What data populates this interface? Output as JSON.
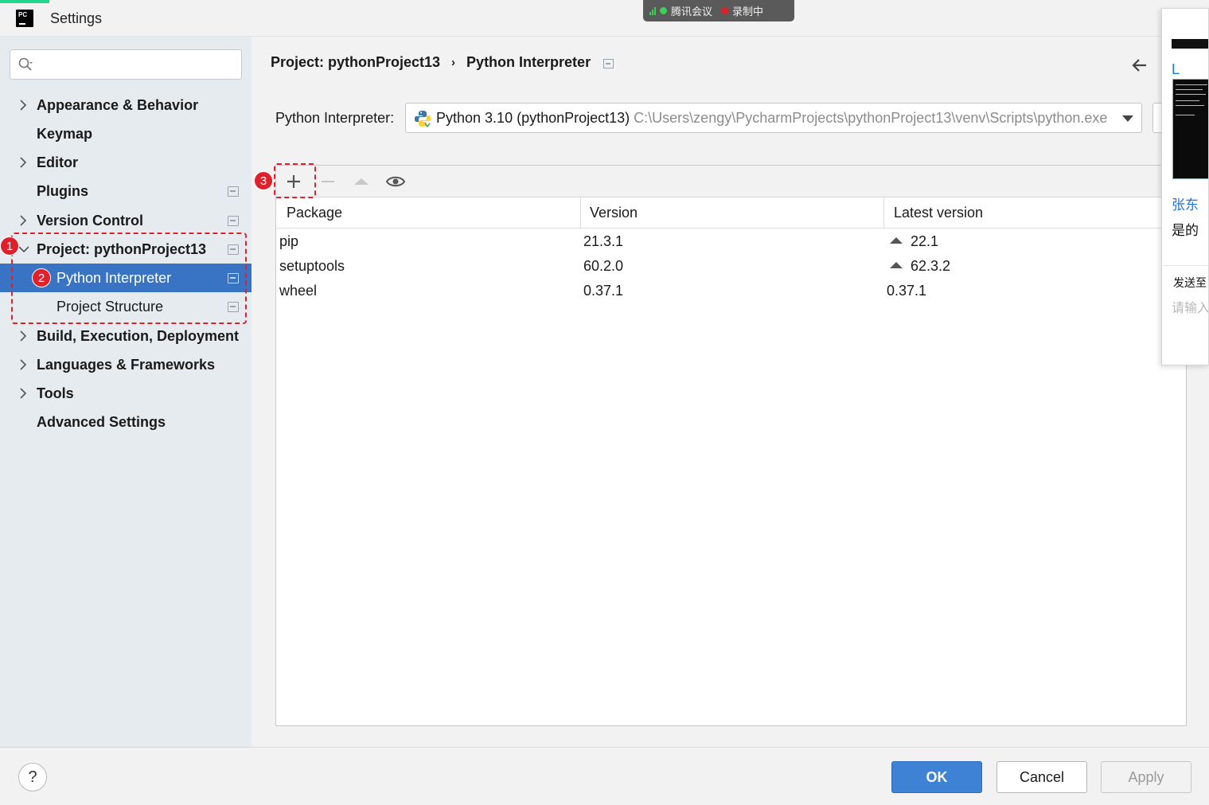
{
  "window": {
    "title": "Settings"
  },
  "meeting_bar": {
    "app": "腾讯会议",
    "recording": "录制中"
  },
  "search": {
    "placeholder": "",
    "value": ""
  },
  "sidebar": {
    "items": [
      {
        "label": "Appearance & Behavior",
        "expandable": true
      },
      {
        "label": "Keymap",
        "expandable": false
      },
      {
        "label": "Editor",
        "expandable": true
      },
      {
        "label": "Plugins",
        "expandable": false
      },
      {
        "label": "Version Control",
        "expandable": true
      },
      {
        "label": "Project: pythonProject13",
        "expandable": true,
        "expanded": true
      },
      {
        "label": "Python Interpreter",
        "child": true,
        "selected": true
      },
      {
        "label": "Project Structure",
        "child": true
      },
      {
        "label": "Build, Execution, Deployment",
        "expandable": true
      },
      {
        "label": "Languages & Frameworks",
        "expandable": true
      },
      {
        "label": "Tools",
        "expandable": true
      },
      {
        "label": "Advanced Settings",
        "expandable": false
      }
    ]
  },
  "annotations": {
    "badge1": "1",
    "badge2": "2",
    "badge3": "3"
  },
  "breadcrumb": {
    "parent": "Project: pythonProject13",
    "separator": "›",
    "current": "Python Interpreter"
  },
  "interpreter": {
    "label": "Python Interpreter:",
    "name": "Python 3.10 (pythonProject13)",
    "path": "C:\\Users\\zengy\\PycharmProjects\\pythonProject13\\venv\\Scripts\\python.exe"
  },
  "packages": {
    "columns": [
      "Package",
      "Version",
      "Latest version"
    ],
    "rows": [
      {
        "package": "pip",
        "version": "21.3.1",
        "latest": "22.1",
        "upgrade": true
      },
      {
        "package": "setuptools",
        "version": "60.2.0",
        "latest": "62.3.2",
        "upgrade": true
      },
      {
        "package": "wheel",
        "version": "0.37.1",
        "latest": "0.37.1",
        "upgrade": false
      }
    ]
  },
  "footer": {
    "help": "?",
    "ok": "OK",
    "cancel": "Cancel",
    "apply": "Apply"
  },
  "chat_overlay": {
    "link": "L",
    "name": "张东",
    "message": "是的",
    "send_to": "发送至",
    "input_placeholder": "请输入"
  },
  "colors": {
    "selection": "#3874c3",
    "ok_button": "#3d82d4",
    "annotation": "#e0202a",
    "sidebar_bg": "#e6ebf0"
  }
}
